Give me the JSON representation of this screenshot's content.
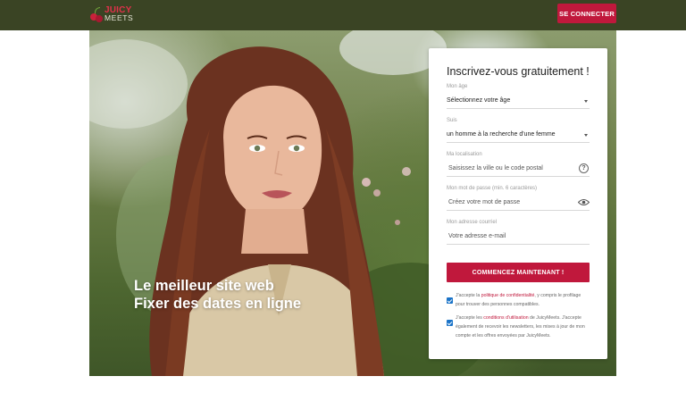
{
  "header": {
    "logo": {
      "line1": "JUICY",
      "line2": "MEETS",
      "icon": "cherry-icon"
    },
    "login_button": "SE CONNECTER"
  },
  "hero": {
    "headline_line1": "Le meilleur site web",
    "headline_line2": "Fixer des dates en ligne"
  },
  "form": {
    "title": "Inscrivez-vous gratuitement !",
    "age": {
      "label": "Mon âge",
      "value": "Sélectionnez votre âge"
    },
    "looking": {
      "label": "Suis",
      "value": "un homme à la recherche d'une femme"
    },
    "location": {
      "label": "Ma localisation",
      "placeholder": "Saisissez la ville ou le code postal",
      "icon": "help-icon"
    },
    "password": {
      "label": "Mon mot de passe (min. 6 caractères)",
      "placeholder": "Créez votre mot de passe",
      "icon": "eye-icon"
    },
    "email": {
      "label": "Mon adresse courriel",
      "placeholder": "Votre adresse e-mail"
    },
    "submit": "COMMENCEZ MAINTENANT !",
    "consent1": {
      "checked": true,
      "before": "J'accepte la ",
      "link": "politique de confidentialité",
      "after": ", y compris le profilage pour trouver des personnes compatibles."
    },
    "consent2": {
      "checked": true,
      "before": "J'accepte les ",
      "link": "conditions d'utilisation",
      "after": " de JuicyMeets. J'accepte également de recevoir les newsletters, les mises à jour de mon compte et les offres envoyées par JuicyMeets."
    }
  },
  "colors": {
    "header_bg": "#3a4424",
    "accent": "#c0183c",
    "checkbox": "#1a73c8"
  }
}
